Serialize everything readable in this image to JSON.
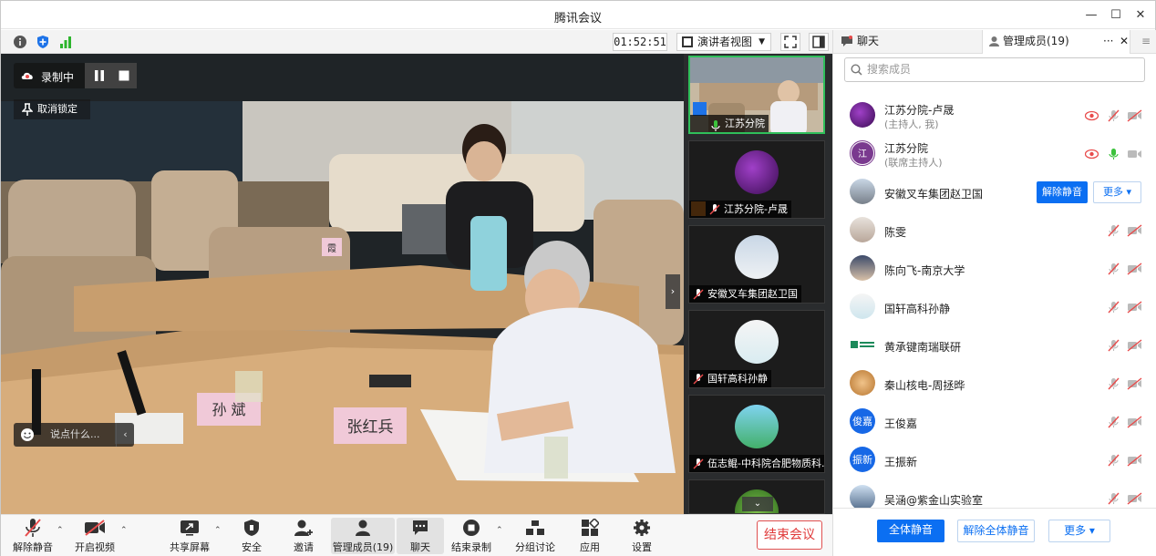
{
  "app": {
    "title": "腾讯会议"
  },
  "toolbar": {
    "timer": "01:52:51",
    "view_label": "演讲者视图"
  },
  "overlays": {
    "recording": "录制中",
    "unpin": "取消锁定",
    "chat_placeholder": "说点什么..."
  },
  "thumbnails": [
    {
      "label": "江苏分院"
    },
    {
      "label": "江苏分院-卢晟"
    },
    {
      "label": "安徽叉车集团赵卫国"
    },
    {
      "label": "国轩高科孙静"
    },
    {
      "label": "伍志鲲-中科院合肥物质科..."
    }
  ],
  "scene": {
    "nameplate_left": "孙 斌",
    "nameplate_right": "张红兵",
    "flag_text": "霞"
  },
  "bottom_bar": {
    "unmute": "解除静音",
    "video": "开启视频",
    "share": "共享屏幕",
    "security": "安全",
    "invite": "邀请",
    "members": "管理成员(19)",
    "chat": "聊天",
    "end_record": "结束录制",
    "breakout": "分组讨论",
    "apps": "应用",
    "settings": "设置",
    "end_meeting": "结束会议"
  },
  "panel": {
    "tab_chat": "聊天",
    "tab_members": "管理成员(19)",
    "search_placeholder": "搜索成员",
    "members": [
      {
        "name": "江苏分院-卢晟",
        "role": "(主持人, 我)"
      },
      {
        "name": "江苏分院",
        "role": "(联席主持人)"
      },
      {
        "name": "安徽叉车集团赵卫国",
        "role": ""
      },
      {
        "name": "陈雯",
        "role": ""
      },
      {
        "name": "陈向飞-南京大学",
        "role": ""
      },
      {
        "name": "国轩高科孙静",
        "role": ""
      },
      {
        "name": "黄承键南瑞联研",
        "role": ""
      },
      {
        "name": "秦山核电-周拯晔",
        "role": ""
      },
      {
        "name": "王俊嘉",
        "role": "",
        "avatar_text": "俊嘉"
      },
      {
        "name": "王振新",
        "role": "",
        "avatar_text": "振新"
      },
      {
        "name": "吴涵@紫金山实验室",
        "role": ""
      }
    ],
    "row_unmute": "解除静音",
    "row_more": "更多",
    "mute_all": "全体静音",
    "unmute_all": "解除全体静音",
    "footer_more": "更多"
  },
  "colors": {
    "accent": "#0b6ff2",
    "end_red": "#e03a3a",
    "muted_red": "#e84b4b",
    "active_green": "#3cc23c"
  }
}
